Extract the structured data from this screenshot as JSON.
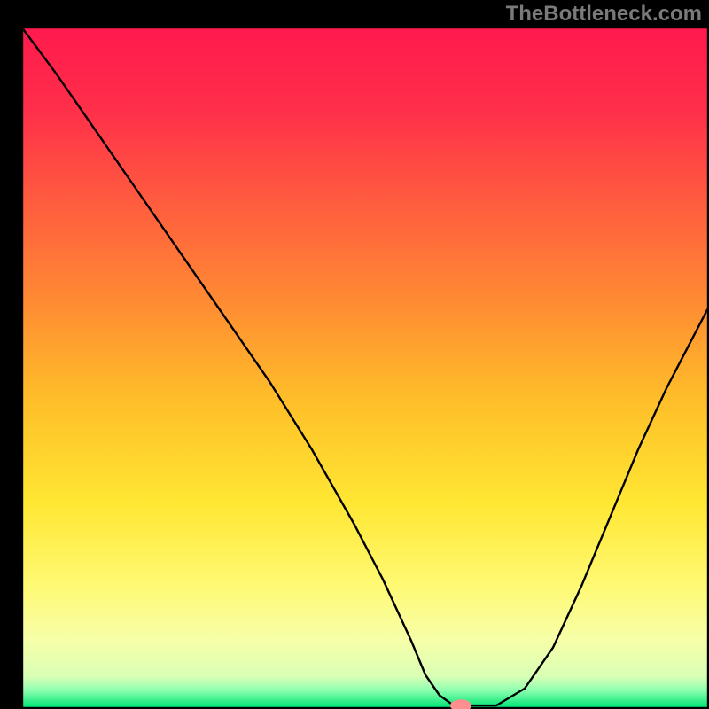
{
  "watermark": "TheBottleneck.com",
  "chart_data": {
    "type": "line",
    "title": "",
    "xlabel": "",
    "ylabel": "",
    "xlim": [
      0,
      100
    ],
    "ylim": [
      0,
      100
    ],
    "frame": {
      "left_x": 3,
      "right_x": 100,
      "top_y": 100,
      "bottom_y": 0,
      "border_color": "#000000",
      "border_width": 2.2
    },
    "background_gradient_colors": [
      {
        "pos": 0.0,
        "hex": "#ff1a4d"
      },
      {
        "pos": 0.12,
        "hex": "#ff2f4a"
      },
      {
        "pos": 0.25,
        "hex": "#ff5a3f"
      },
      {
        "pos": 0.4,
        "hex": "#ff8a33"
      },
      {
        "pos": 0.55,
        "hex": "#ffbf29"
      },
      {
        "pos": 0.7,
        "hex": "#ffe733"
      },
      {
        "pos": 0.82,
        "hex": "#fff973"
      },
      {
        "pos": 0.9,
        "hex": "#f7ffa8"
      },
      {
        "pos": 0.955,
        "hex": "#d9ffb5"
      },
      {
        "pos": 0.975,
        "hex": "#8fffb0"
      },
      {
        "pos": 1.0,
        "hex": "#00e676"
      }
    ],
    "series": [
      {
        "name": "bottleneck-curve",
        "color": "#000000",
        "width": 2.4,
        "x": [
          3,
          8,
          14,
          20,
          26,
          32,
          38,
          44,
          50,
          54,
          58,
          60,
          62,
          64,
          66,
          70,
          74,
          78,
          82,
          86,
          90,
          94,
          98,
          100
        ],
        "values": [
          100,
          93,
          84,
          75,
          66,
          57,
          48,
          38,
          27,
          19,
          10,
          5,
          2,
          0.5,
          0.5,
          0.5,
          3,
          9,
          18,
          28,
          38,
          47,
          55,
          59
        ]
      }
    ],
    "marker": {
      "name": "optimal-point",
      "x": 65,
      "y": 0.5,
      "color": "#ff8e8e",
      "rx": 1.5,
      "ry": 0.9
    }
  }
}
